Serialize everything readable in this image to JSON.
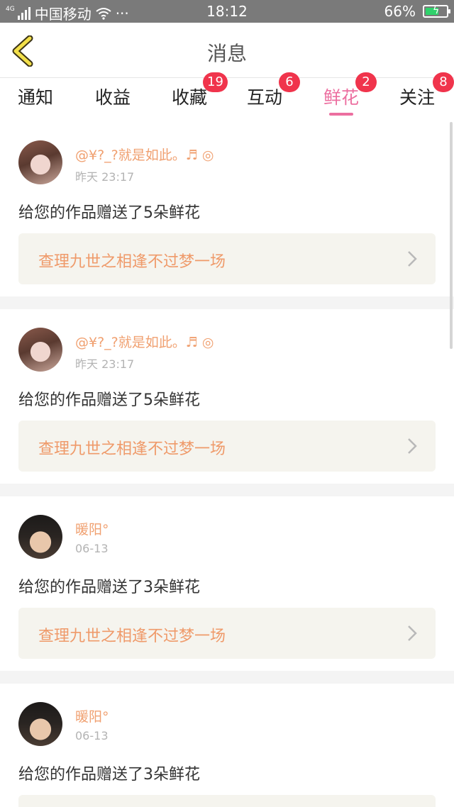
{
  "status_bar": {
    "network": "4G",
    "carrier": "中国移动",
    "more": "···",
    "time": "18:12",
    "battery": "66%",
    "battery_level": 0.66
  },
  "header": {
    "title": "消息"
  },
  "tabs": [
    {
      "label": "通知"
    },
    {
      "label": "收益"
    },
    {
      "label": "收藏",
      "badge": "19"
    },
    {
      "label": "互动",
      "badge": "6"
    },
    {
      "label": "鲜花",
      "badge": "2",
      "active": true
    },
    {
      "label": "关注",
      "badge": "8"
    }
  ],
  "messages": [
    {
      "user": "@¥?_?就是如此。♬ ◎",
      "time": "昨天 23:17",
      "text": "给您的作品赠送了5朵鲜花",
      "work": "查理九世之相逢不过梦一场"
    },
    {
      "user": "@¥?_?就是如此。♬ ◎",
      "time": "昨天 23:17",
      "text": "给您的作品赠送了5朵鲜花",
      "work": "查理九世之相逢不过梦一场"
    },
    {
      "user": "暖阳°",
      "time": "06-13",
      "text": "给您的作品赠送了3朵鲜花",
      "work": "查理九世之相逢不过梦一场"
    },
    {
      "user": "暖阳°",
      "time": "06-13",
      "text": "给您的作品赠送了3朵鲜花",
      "work": ""
    }
  ],
  "colors": {
    "accent": "#ec6fa0",
    "badge": "#f0344c",
    "username": "#f0a070",
    "work_title": "#ef9a6a"
  }
}
